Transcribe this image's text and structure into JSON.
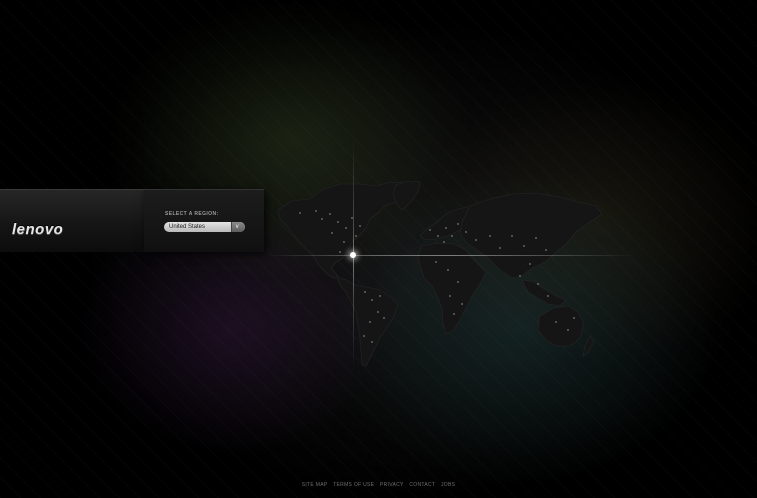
{
  "brand": {
    "logo_text": "lenovo"
  },
  "region_selector": {
    "label": "SELECT A REGION:",
    "selected": "United States",
    "arrow_icon": "chevron-down-icon"
  },
  "footer": {
    "links": [
      "SITE MAP",
      "TERMS OF USE",
      "PRIVACY",
      "CONTACT",
      "JOBS"
    ]
  },
  "colors": {
    "background": "#000000",
    "map_fill": "#161616",
    "footer_text": "#6f6f6f",
    "select_fill": "#cfcfcf"
  }
}
